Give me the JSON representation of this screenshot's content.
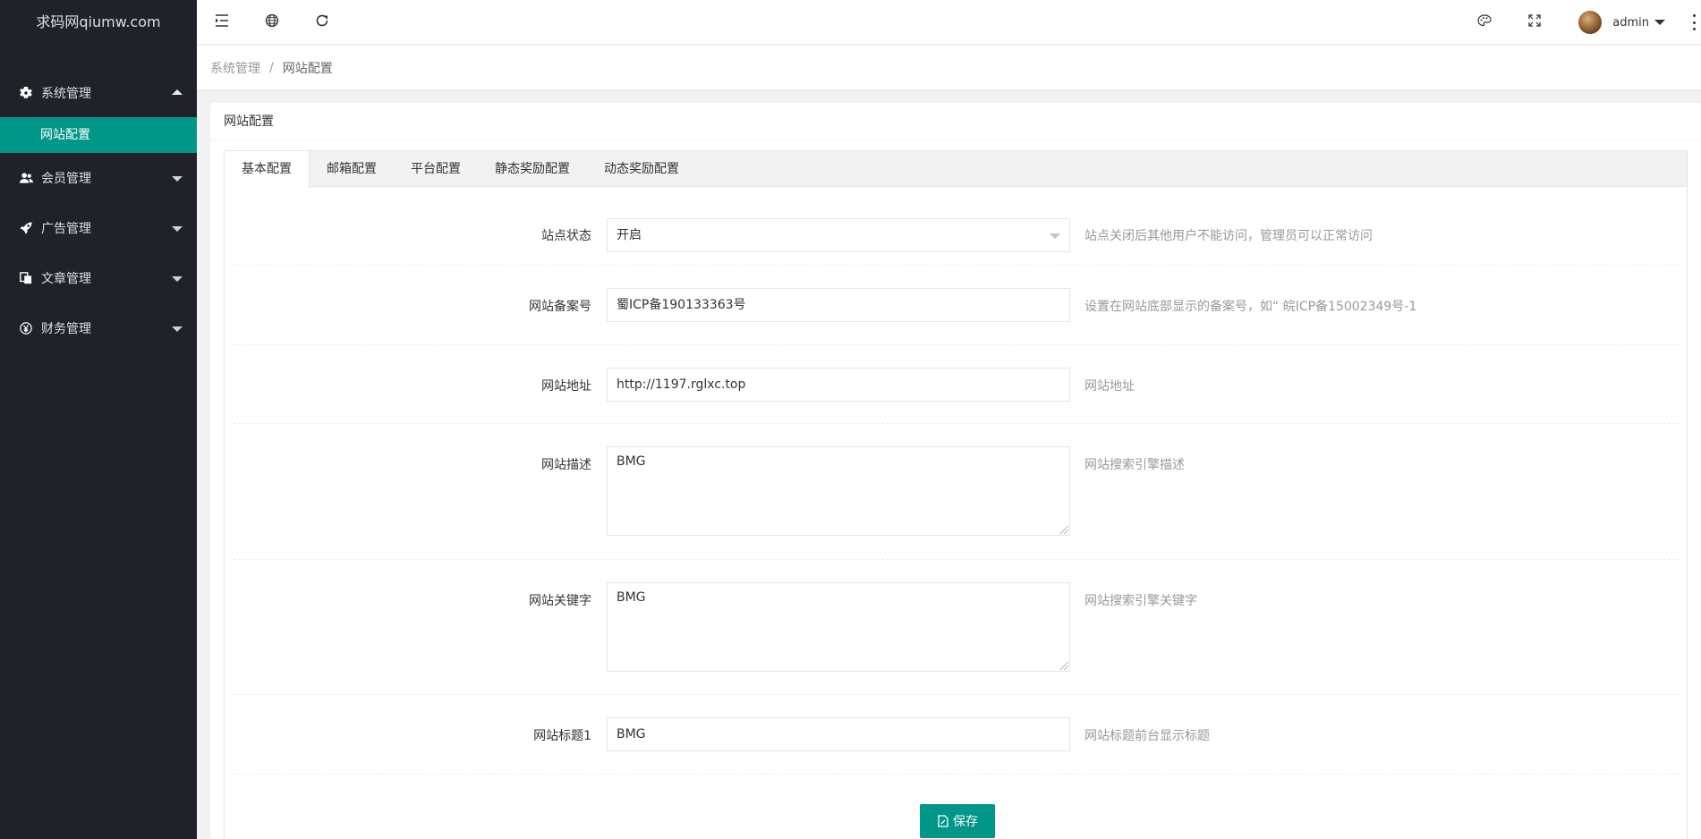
{
  "sidebar": {
    "logo": "求码网qiumw.com",
    "groups": [
      {
        "label": "系统管理",
        "icon": "gear-icon",
        "open": true,
        "children": [
          {
            "label": "网站配置",
            "active": true
          }
        ]
      },
      {
        "label": "会员管理",
        "icon": "users-icon",
        "open": false
      },
      {
        "label": "广告管理",
        "icon": "rocket-icon",
        "open": false
      },
      {
        "label": "文章管理",
        "icon": "documents-icon",
        "open": false
      },
      {
        "label": "财务管理",
        "icon": "yen-icon",
        "open": false
      }
    ]
  },
  "header": {
    "user_name": "admin",
    "icons": [
      "menu-fold-icon",
      "globe-icon",
      "refresh-icon",
      "theme-icon",
      "fullscreen-icon",
      "more-icon"
    ]
  },
  "breadcrumb": {
    "parent": "系统管理",
    "separator": "/",
    "current": "网站配置"
  },
  "card": {
    "title": "网站配置"
  },
  "tabs": [
    {
      "label": "基本配置",
      "active": true
    },
    {
      "label": "邮箱配置"
    },
    {
      "label": "平台配置"
    },
    {
      "label": "静态奖励配置"
    },
    {
      "label": "动态奖励配置"
    }
  ],
  "form": {
    "site_status": {
      "label": "站点状态",
      "value": "开启",
      "tip": "站点关闭后其他用户不能访问，管理员可以正常访问"
    },
    "icp": {
      "label": "网站备案号",
      "value": "蜀ICP备190133363号",
      "tip": "设置在网站底部显示的备案号，如“ 皖ICP备15002349号-1"
    },
    "url": {
      "label": "网站地址",
      "value": "http://1197.rglxc.top",
      "tip": "网站地址"
    },
    "description": {
      "label": "网站描述",
      "value": "BMG",
      "tip": "网站搜索引擎描述"
    },
    "keywords": {
      "label": "网站关键字",
      "value": "BMG",
      "tip": "网站搜索引擎关键字"
    },
    "title1": {
      "label": "网站标题1",
      "value": "BMG",
      "tip": "网站标题前台显示标题"
    }
  },
  "save_label": "保存",
  "colors": {
    "sidebar_bg": "#20222a",
    "accent": "#009688"
  }
}
